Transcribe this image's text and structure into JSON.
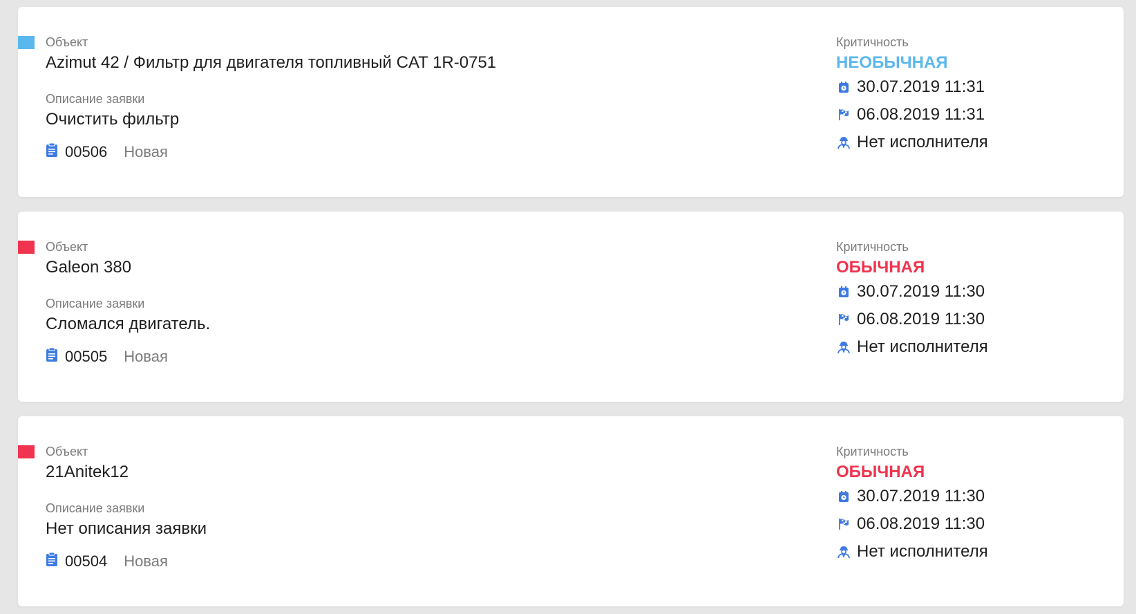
{
  "labels": {
    "object": "Объект",
    "description": "Описание заявки",
    "criticality": "Критичность"
  },
  "colors": {
    "unusual": "#5bb8ee",
    "usual": "#f0344f",
    "icon_blue": "#3d7be3"
  },
  "icons": {
    "ticket": "clipboard-icon",
    "created": "calendar-clock-icon",
    "deadline": "checkered-flag-icon",
    "assignee": "worker-icon"
  },
  "cards": [
    {
      "object": "Azimut 42 / Фильтр для двигателя топливный CAT 1R-0751",
      "description": "Очистить фильтр",
      "number": "00506",
      "status": "Новая",
      "criticality": "НЕОБЫЧНАЯ",
      "criticality_color": "#5bb8ee",
      "created": "30.07.2019 11:31",
      "deadline": "06.08.2019 11:31",
      "assignee": "Нет исполнителя"
    },
    {
      "object": "Galeon 380",
      "description": "Сломался двигатель.",
      "number": "00505",
      "status": "Новая",
      "criticality": "ОБЫЧНАЯ",
      "criticality_color": "#f0344f",
      "created": "30.07.2019 11:30",
      "deadline": "06.08.2019 11:30",
      "assignee": "Нет исполнителя"
    },
    {
      "object": "21Anitek12",
      "description": "Нет описания заявки",
      "number": "00504",
      "status": "Новая",
      "criticality": "ОБЫЧНАЯ",
      "criticality_color": "#f0344f",
      "created": "30.07.2019 11:30",
      "deadline": "06.08.2019 11:30",
      "assignee": "Нет исполнителя"
    }
  ]
}
